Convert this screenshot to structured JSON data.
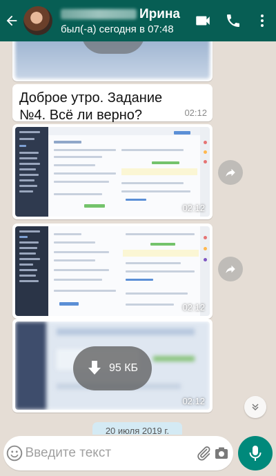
{
  "header": {
    "contact_name": "Ирина",
    "status": "был(-а) сегодня в 07:48",
    "icons": [
      "back-arrow-icon",
      "video-call-icon",
      "phone-icon",
      "more-vert-icon"
    ]
  },
  "messages": [
    {
      "type": "image",
      "time": ""
    },
    {
      "type": "text",
      "text": "Доброе утро. Задание №4. Всё ли верно?",
      "time": "02:12"
    },
    {
      "type": "image",
      "time": "02:12"
    },
    {
      "type": "image",
      "time": "02:12"
    },
    {
      "type": "image-download",
      "size": "95 КБ",
      "time": "02:12"
    }
  ],
  "date_separator": "20 июля 2019 г.",
  "composer": {
    "placeholder": "Введите текст",
    "icons": [
      "emoji-icon",
      "attach-icon",
      "camera-icon",
      "mic-icon"
    ]
  },
  "colors": {
    "header": "#075e54",
    "chat_background": "#e5ddd5",
    "mic_button": "#00897b",
    "date_pill": "#d4eaf4"
  }
}
